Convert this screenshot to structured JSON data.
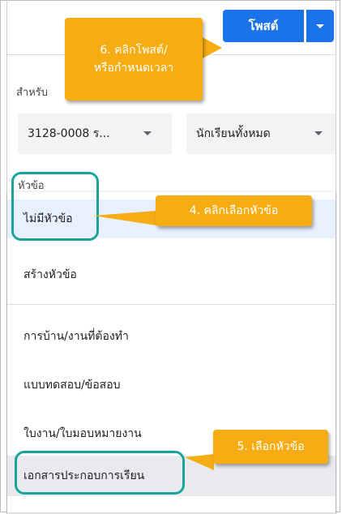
{
  "header": {
    "post_label": "โพสต์"
  },
  "assign": {
    "for_label": "สำหรับ",
    "class_value": "3128-0008 ร...",
    "students_value": "นักเรียนทั้งหมด"
  },
  "topic": {
    "label": "หัวข้อ",
    "options": [
      "ไม่มีหัวข้อ",
      "สร้างหัวข้อ",
      "การบ้าน/งานที่ต้องทำ",
      "แบบทดสอบ/ข้อสอบ",
      "ใบงาน/ใบมอบหมายงาน",
      "เอกสารประกอบการเรียน"
    ]
  },
  "annotations": {
    "step6_line1": "6. คลิกโพสต์/",
    "step6_line2": "หรือกำหนดเวลา",
    "step4": "4. คลิกเลือกหัวข้อ",
    "step5": "5. เลือกหัวข้อ",
    "callout_color": "#f5ad13",
    "highlight_color": "#1aa39a"
  },
  "colors": {
    "primary": "#1a73e8",
    "selected_bg": "#e8f0fe"
  }
}
